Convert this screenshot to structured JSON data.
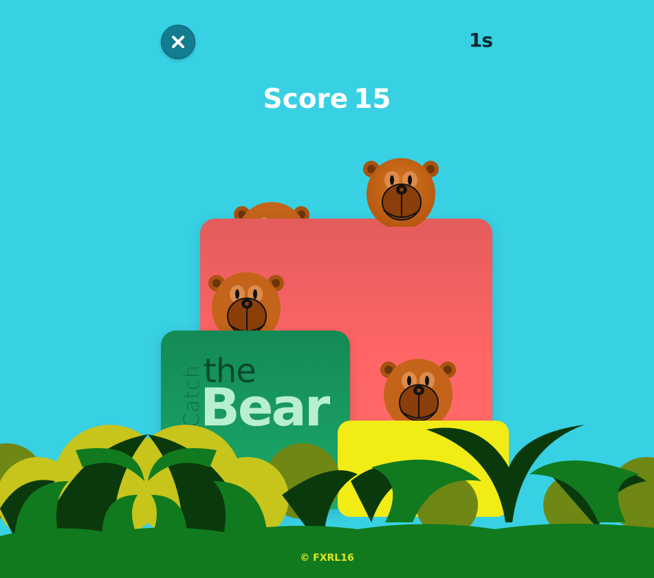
{
  "hud": {
    "close_icon": "close-icon",
    "timer": "1s",
    "score_label": "Score",
    "score_value": "15"
  },
  "logo": {
    "word_catch": "Catch",
    "word_the": "the",
    "word_bear": "Bear"
  },
  "footer": {
    "copyright": "© FXRL16"
  },
  "colors": {
    "sky": "#38d0e3",
    "red_card": "#ff6565",
    "green_card": "#1caa6a",
    "yellow_card": "#f2ec16",
    "bear_fur": "#c3641a",
    "bush_dark": "#0a3a0c",
    "bush_green": "#117a1f",
    "bush_yellow": "#c7c41c",
    "bush_olive": "#6f8714"
  },
  "bears": [
    {
      "id": "bear-1",
      "icon": "bear-face-icon"
    },
    {
      "id": "bear-2",
      "icon": "bear-face-icon"
    },
    {
      "id": "bear-3",
      "icon": "bear-face-icon"
    },
    {
      "id": "bear-4",
      "icon": "bear-face-icon"
    }
  ]
}
